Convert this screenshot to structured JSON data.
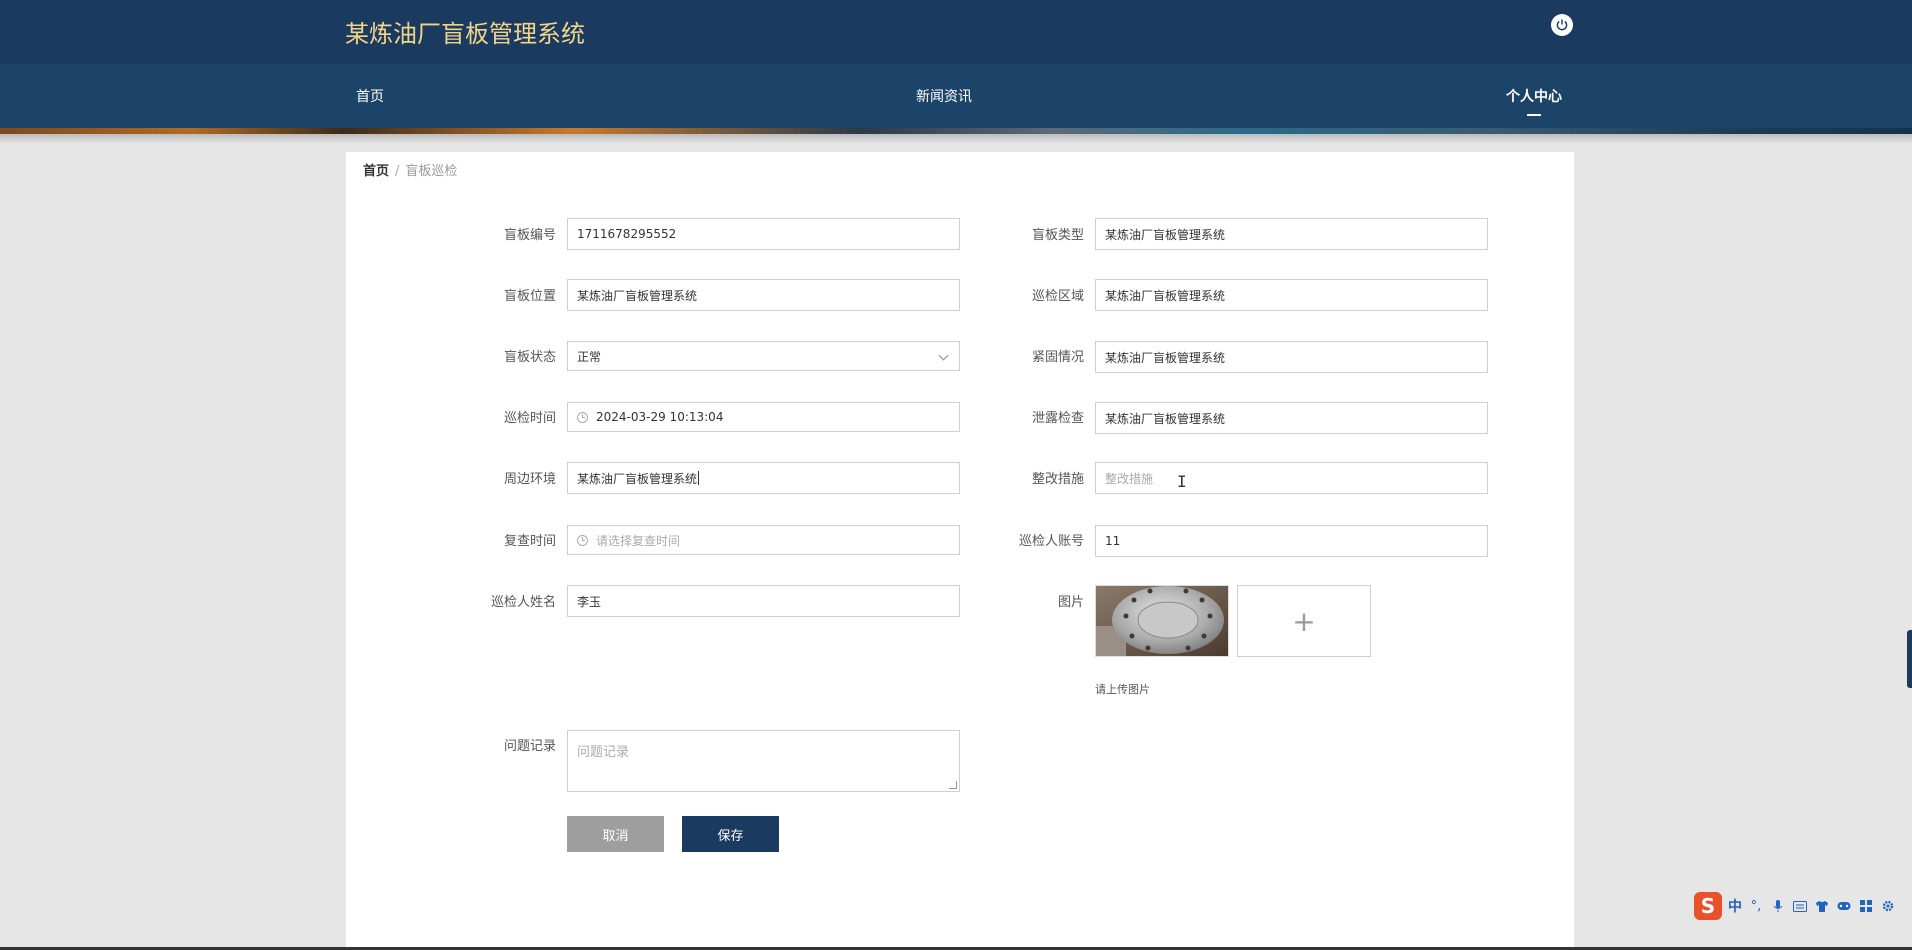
{
  "header": {
    "title": "某炼油厂盲板管理系统",
    "power_icon": "power-icon"
  },
  "nav": {
    "items": [
      {
        "label": "首页"
      },
      {
        "label": "新闻资讯"
      },
      {
        "label": "个人中心",
        "active": true
      }
    ]
  },
  "breadcrumb": {
    "home": "首页",
    "separator": "/",
    "current": "盲板巡检"
  },
  "form": {
    "mbbh": {
      "label": "盲板编号",
      "value": "1711678295552"
    },
    "mblx": {
      "label": "盲板类型",
      "value": "某炼油厂盲板管理系统"
    },
    "mbwz": {
      "label": "盲板位置",
      "value": "某炼油厂盲板管理系统"
    },
    "xjqy": {
      "label": "巡检区域",
      "value": "某炼油厂盲板管理系统"
    },
    "mbzt": {
      "label": "盲板状态",
      "value": "正常"
    },
    "jgqk": {
      "label": "紧固情况",
      "value": "某炼油厂盲板管理系统"
    },
    "xjsj": {
      "label": "巡检时间",
      "value": "2024-03-29 10:13:04"
    },
    "xljc": {
      "label": "泄露检查",
      "value": "某炼油厂盲板管理系统"
    },
    "zbhj": {
      "label": "周边环境",
      "value": "某炼油厂盲板管理系统"
    },
    "zgcs": {
      "label": "整改措施",
      "value": "",
      "placeholder": "整改措施"
    },
    "fcsj": {
      "label": "复查时间",
      "value": "",
      "placeholder": "请选择复查时间"
    },
    "xjrzh": {
      "label": "巡检人账号",
      "value": "11"
    },
    "xjrxm": {
      "label": "巡检人姓名",
      "value": "李玉"
    },
    "tp": {
      "label": "图片",
      "hint": "请上传图片",
      "upload_symbol": "+"
    },
    "wtjl": {
      "label": "问题记录",
      "placeholder": "问题记录"
    }
  },
  "buttons": {
    "cancel": "取消",
    "save": "保存"
  },
  "ime": {
    "logo": "S",
    "mode": "中",
    "punct": "°,"
  },
  "colors": {
    "header_bg": "#1b3a5f",
    "nav_bg": "#1c4468",
    "title_color": "#f1d58a",
    "save_bg": "#1b3a5f",
    "cancel_bg": "#9e9e9e"
  }
}
